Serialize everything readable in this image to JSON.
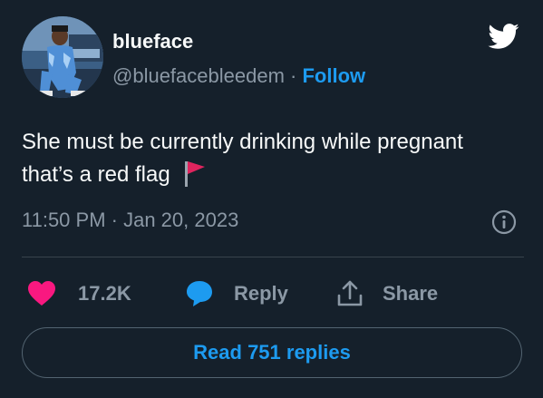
{
  "author": {
    "name": "blueface",
    "handle": "@bluefacebleedem",
    "separator": "·",
    "follow_label": "Follow"
  },
  "tweet": {
    "text": "She must be currently drinking while pregnant that’s a red flag",
    "emoji": "red-flag",
    "timestamp": "11:50 PM · Jan 20, 2023"
  },
  "actions": {
    "like_count": "17.2K",
    "reply_label": "Reply",
    "share_label": "Share"
  },
  "read_replies_label": "Read 751 replies",
  "colors": {
    "background": "#15202b",
    "accent": "#1d9bf0",
    "like": "#f91880",
    "muted": "#8b98a5",
    "text": "#f7f9f9"
  }
}
